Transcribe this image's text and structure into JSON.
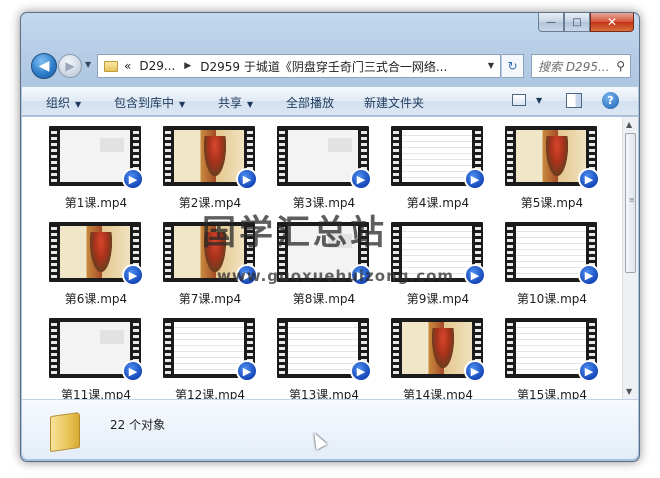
{
  "window": {
    "caption": {
      "minimize": "—",
      "maximize": "□",
      "close": "✕"
    }
  },
  "nav": {
    "back_glyph": "◀",
    "forward_glyph": "▶",
    "history_glyph": "▼",
    "address": {
      "overflow": "«",
      "segments": [
        "D29...",
        "D2959 于城道《阴盘穿壬奇门三式合一网络..."
      ],
      "separator": "▶",
      "dropdown": "▼"
    },
    "refresh_glyph": "↻",
    "search": {
      "placeholder": "搜索 D295..."
    }
  },
  "command_bar": {
    "organize": "组织",
    "include_in_library": "包含到库中",
    "share": "共享",
    "play_all": "全部播放",
    "new_folder": "新建文件夹",
    "dropdown_glyph": "▼",
    "help_glyph": "?"
  },
  "files": [
    {
      "name": "第1课.mp4",
      "thumb": "blank"
    },
    {
      "name": "第2课.mp4",
      "thumb": "paint"
    },
    {
      "name": "第3课.mp4",
      "thumb": "blank"
    },
    {
      "name": "第4课.mp4",
      "thumb": "doc"
    },
    {
      "name": "第5课.mp4",
      "thumb": "paint"
    },
    {
      "name": "第6课.mp4",
      "thumb": "paint"
    },
    {
      "name": "第7课.mp4",
      "thumb": "paint"
    },
    {
      "name": "第8课.mp4",
      "thumb": "blank"
    },
    {
      "name": "第9课.mp4",
      "thumb": "doc"
    },
    {
      "name": "第10课.mp4",
      "thumb": "doc"
    },
    {
      "name": "第11课.mp4",
      "thumb": "blank"
    },
    {
      "name": "第12课.mp4",
      "thumb": "doc"
    },
    {
      "name": "第13课.mp4",
      "thumb": "doc"
    },
    {
      "name": "第14课.mp4",
      "thumb": "paint"
    },
    {
      "name": "第15课.mp4",
      "thumb": "doc"
    }
  ],
  "watermark": {
    "title": "国学汇总站",
    "url": "www.guoxuehuizong.com"
  },
  "scrollbar": {
    "up_glyph": "▲",
    "down_glyph": "▼",
    "grip_glyph": "≡"
  },
  "details": {
    "status": "22 个对象"
  },
  "colors": {
    "accent": "#1e395b",
    "media_badge": "#1546b8",
    "close_button": "#c23216"
  }
}
